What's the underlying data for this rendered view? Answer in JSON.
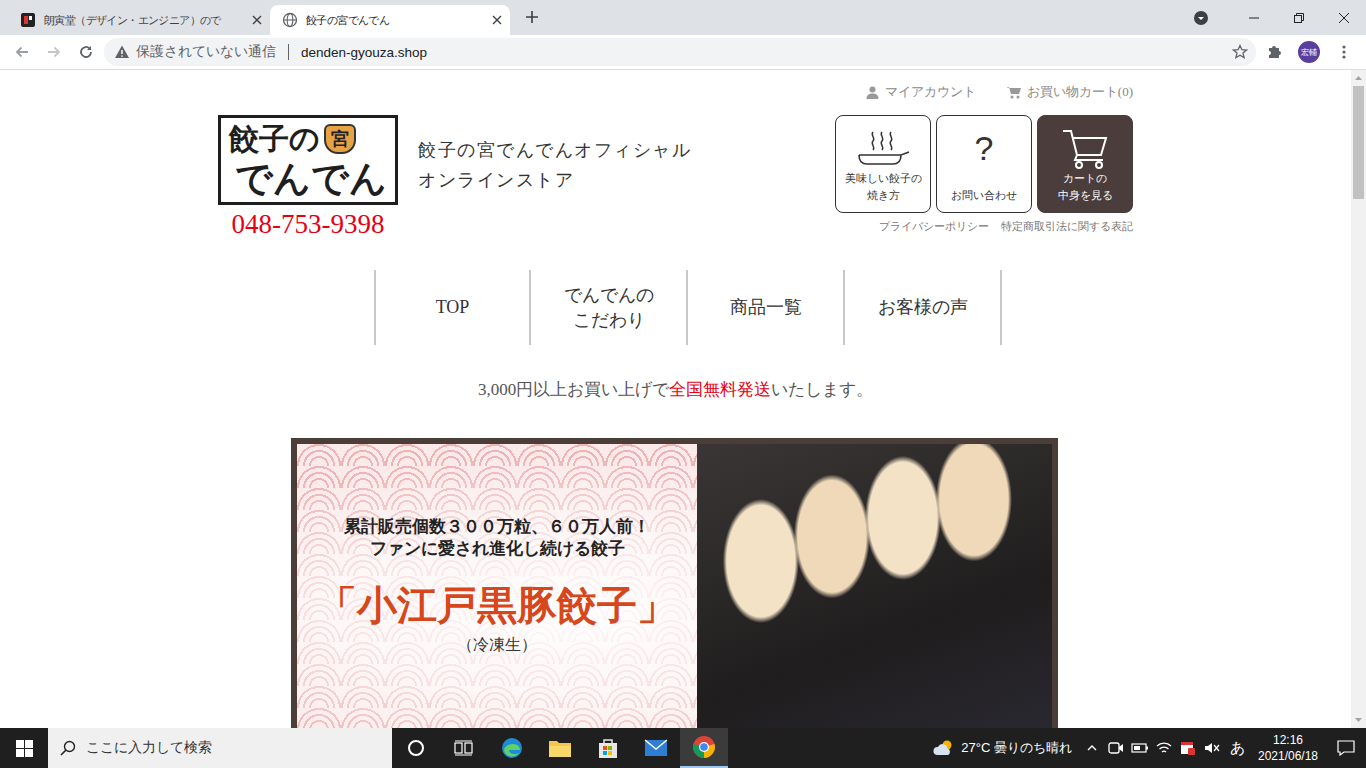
{
  "browser": {
    "tabs": [
      {
        "label": "朗寅堂（デザイン・エンジニア）ので",
        "selected": false
      },
      {
        "label": "餃子の宮でんでん",
        "selected": true
      }
    ],
    "address": {
      "security": "保護されていない通信",
      "url": "denden-gyouza.shop"
    },
    "profile": "宏輔",
    "scrollbar": {
      "level": 0.18
    }
  },
  "site": {
    "account_links": [
      "マイアカウント",
      "お買い物カート(0)"
    ],
    "logo": {
      "top": "餃子の",
      "mark": "宮",
      "bottom": "でんでん"
    },
    "phone": "048-753-9398",
    "title": [
      "餃子の宮でんでんオフィシャル",
      "オンラインストア"
    ],
    "buttons": [
      {
        "lines": [
          "美味しい餃子の",
          "焼き方"
        ],
        "kind": "howto"
      },
      {
        "lines": [
          "お問い合わせ"
        ],
        "kind": "contact",
        "icon": "?"
      },
      {
        "lines": [
          "カートの",
          "中身を見る"
        ],
        "kind": "cart"
      }
    ],
    "footer_links": [
      "プライバシーポリシー",
      "特定商取引法に関する表記"
    ],
    "nav": [
      {
        "lines": [
          "TOP"
        ]
      },
      {
        "lines": [
          "でんでんの",
          "こだわり"
        ]
      },
      {
        "lines": [
          "商品一覧"
        ]
      },
      {
        "lines": [
          "お客様の声"
        ]
      }
    ],
    "shipping": {
      "before": "3,000円以上お買い上げで",
      "highlight": "全国無料発送",
      "after": "いたします。"
    },
    "banner": {
      "lines": [
        "累計販売個数３００万粒、６０万人前！",
        "ファンに愛され進化し続ける餃子"
      ],
      "title": "「小江戸黒豚餃子」",
      "note": "（冷凍生）"
    }
  },
  "taskbar": {
    "search_placeholder": "ここに入力して検索",
    "weather": "27°C  曇りのち晴れ",
    "ime": "あ",
    "time": "12:16",
    "date": "2021/06/18"
  }
}
